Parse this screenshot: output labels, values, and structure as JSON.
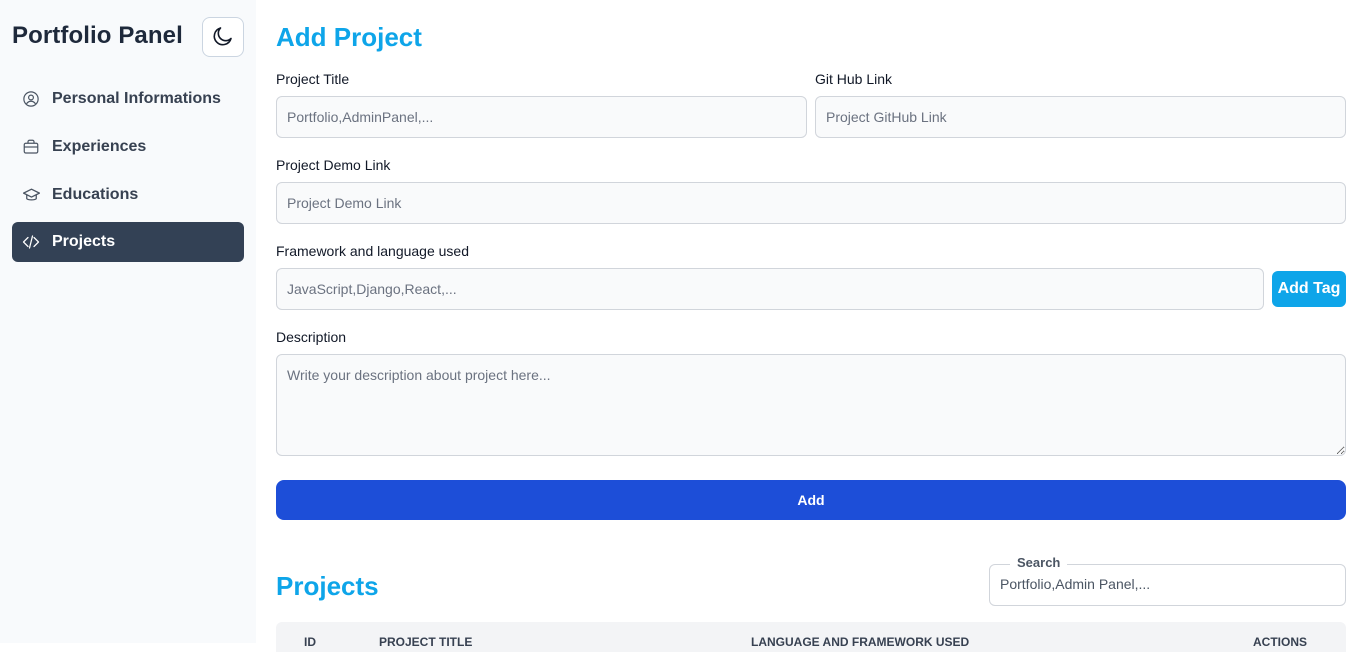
{
  "app": {
    "title": "Portfolio Panel",
    "theme_icon": "moon-icon"
  },
  "sidebar": {
    "items": [
      {
        "label": "Personal Informations",
        "icon": "user-circle-icon",
        "active": false
      },
      {
        "label": "Experiences",
        "icon": "briefcase-icon",
        "active": false
      },
      {
        "label": "Educations",
        "icon": "graduation-cap-icon",
        "active": false
      },
      {
        "label": "Projects",
        "icon": "code-icon",
        "active": true
      }
    ]
  },
  "form": {
    "title": "Add Project",
    "project_title": {
      "label": "Project Title",
      "placeholder": "Portfolio,AdminPanel,..."
    },
    "github": {
      "label": "Git Hub Link",
      "placeholder": "Project GitHub Link"
    },
    "demo": {
      "label": "Project Demo Link",
      "placeholder": "Project Demo Link"
    },
    "frameworks": {
      "label": "Framework and language used",
      "placeholder": "JavaScript,Django,React,..."
    },
    "add_tag_label": "Add Tag",
    "description": {
      "label": "Description",
      "placeholder": "Write your description about project here..."
    },
    "submit_label": "Add"
  },
  "projects": {
    "title": "Projects",
    "search": {
      "legend": "Search",
      "placeholder": "Portfolio,Admin Panel,..."
    },
    "columns": [
      "ID",
      "PROJECT TITLE",
      "LANGUAGE AND FRAMEWORK USED",
      "ACTIONS"
    ]
  },
  "colors": {
    "accent": "#0ea5e9",
    "primary": "#1d4ed8",
    "active_nav": "#334155"
  }
}
